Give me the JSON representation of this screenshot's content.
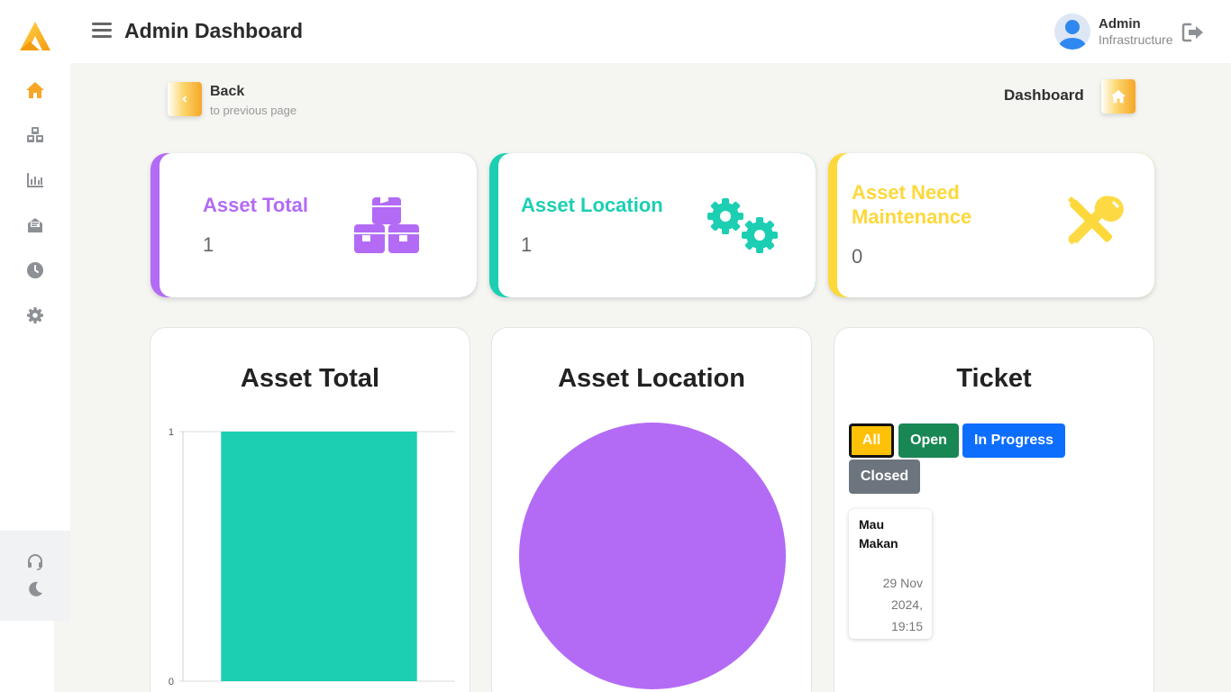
{
  "header": {
    "title": "Admin Dashboard",
    "user_name": "Admin",
    "user_role": "Infrastructure"
  },
  "sidebar": {
    "items": [
      {
        "icon": "home-icon",
        "active": true
      },
      {
        "icon": "cubes-icon"
      },
      {
        "icon": "chart-icon"
      },
      {
        "icon": "inbox-icon"
      },
      {
        "icon": "clock-icon"
      },
      {
        "icon": "gear-icon"
      }
    ],
    "bottom": [
      {
        "icon": "headset-icon"
      },
      {
        "icon": "moon-icon"
      }
    ]
  },
  "nav": {
    "back_label": "Back",
    "back_sub": "to previous page",
    "breadcrumb": "Dashboard"
  },
  "stats": [
    {
      "title": "Asset Total",
      "value": "1",
      "color": "#b36bf5",
      "icon": "cubes-icon"
    },
    {
      "title": "Asset Location",
      "value": "1",
      "color": "#1ccfb2",
      "icon": "gears-icon"
    },
    {
      "title": "Asset Need Maintenance",
      "value": "0",
      "color": "#fdd83a",
      "icon": "tools-icon"
    }
  ],
  "panels": {
    "asset_total_title": "Asset Total",
    "asset_location_title": "Asset Location",
    "ticket_title": "Ticket"
  },
  "chart_data": [
    {
      "type": "bar",
      "categories": [
        ""
      ],
      "values": [
        1
      ],
      "ylim": [
        0,
        1
      ],
      "yticks": [
        "0",
        "1"
      ],
      "colors": [
        "#1ccfb2"
      ]
    },
    {
      "type": "pie",
      "values": [
        1
      ],
      "colors": [
        "#b36bf5"
      ]
    }
  ],
  "ticket": {
    "filters": [
      {
        "label": "All",
        "color": "#ffc107",
        "active": true
      },
      {
        "label": "Open",
        "color": "#198754"
      },
      {
        "label": "In Progress",
        "color": "#0d6efd"
      },
      {
        "label": "Closed",
        "color": "#6c757d"
      }
    ],
    "items": [
      {
        "title": "Mau Makan",
        "date": "29 Nov 2024, 19:15"
      }
    ]
  },
  "colors": {
    "accent": "#f6a727",
    "purple": "#b36bf5",
    "teal": "#1ccfb2",
    "yellow": "#fdd83a"
  }
}
